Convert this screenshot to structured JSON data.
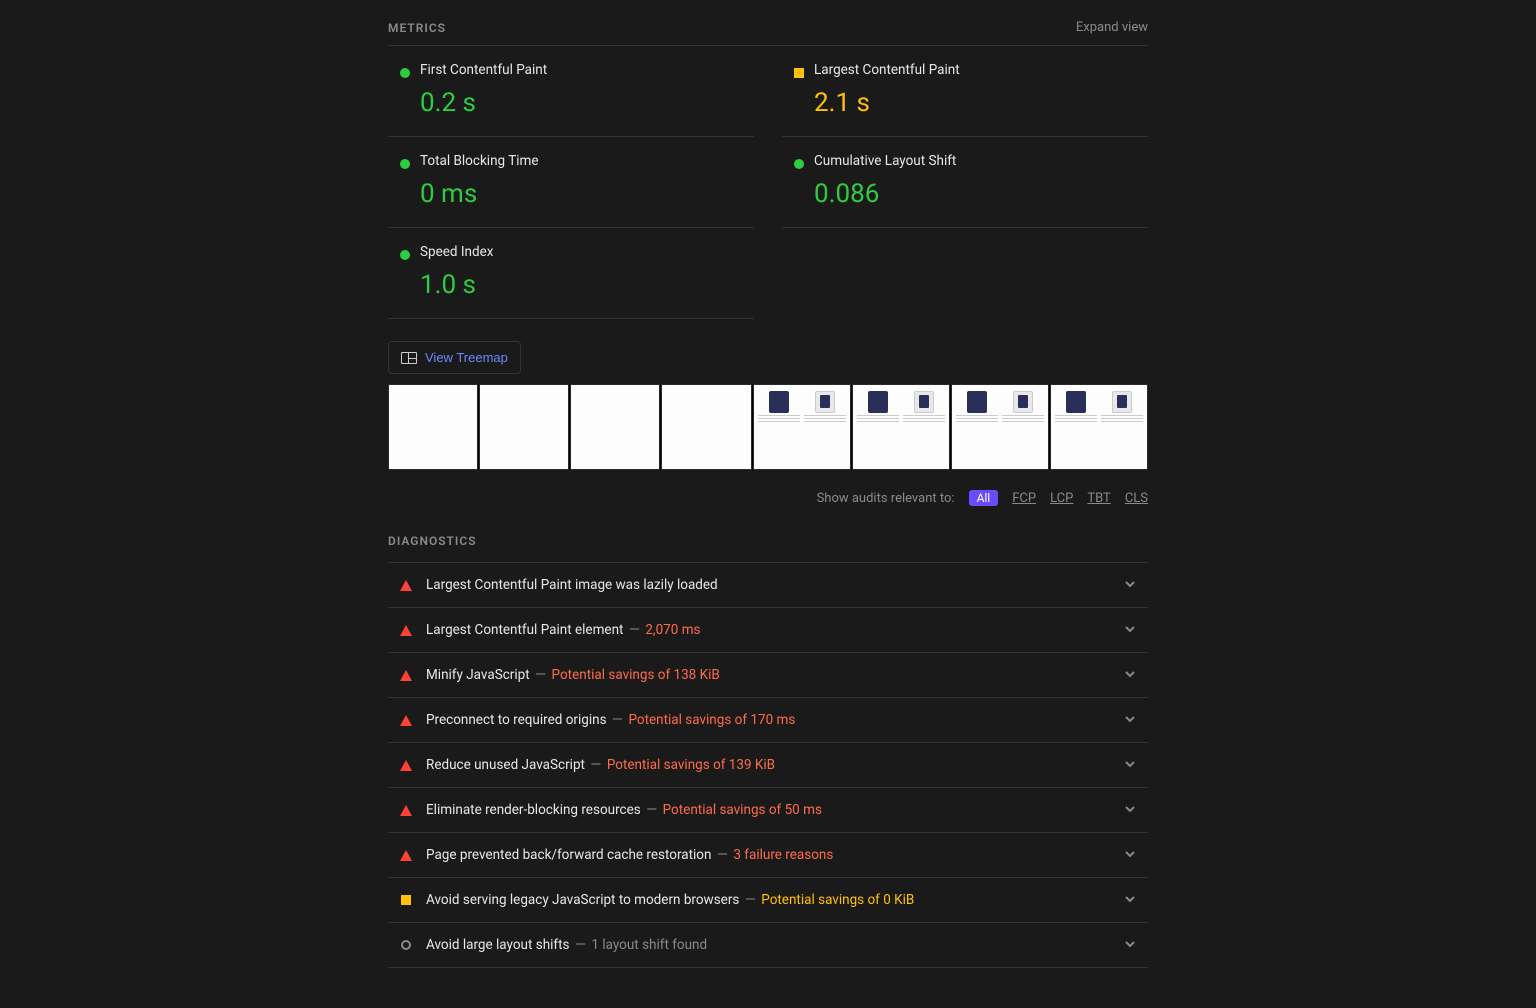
{
  "sections": {
    "metrics_title": "METRICS",
    "expand_view": "Expand view",
    "diagnostics_title": "DIAGNOSTICS"
  },
  "metrics": [
    {
      "label": "First Contentful Paint",
      "value": "0.2 s",
      "status": "green"
    },
    {
      "label": "Largest Contentful Paint",
      "value": "2.1 s",
      "status": "yellow"
    },
    {
      "label": "Total Blocking Time",
      "value": "0 ms",
      "status": "green"
    },
    {
      "label": "Cumulative Layout Shift",
      "value": "0.086",
      "status": "green"
    },
    {
      "label": "Speed Index",
      "value": "1.0 s",
      "status": "green"
    }
  ],
  "treemap_button": "View Treemap",
  "audit_filter": {
    "label": "Show audits relevant to:",
    "options": [
      "All",
      "FCP",
      "LCP",
      "TBT",
      "CLS"
    ],
    "active": "All"
  },
  "diagnostics": [
    {
      "status": "red",
      "title": "Largest Contentful Paint image was lazily loaded",
      "detail": "",
      "detail_tone": ""
    },
    {
      "status": "red",
      "title": "Largest Contentful Paint element",
      "detail": "2,070 ms",
      "detail_tone": "red"
    },
    {
      "status": "red",
      "title": "Minify JavaScript",
      "detail": "Potential savings of 138 KiB",
      "detail_tone": "red"
    },
    {
      "status": "red",
      "title": "Preconnect to required origins",
      "detail": "Potential savings of 170 ms",
      "detail_tone": "red"
    },
    {
      "status": "red",
      "title": "Reduce unused JavaScript",
      "detail": "Potential savings of 139 KiB",
      "detail_tone": "red"
    },
    {
      "status": "red",
      "title": "Eliminate render-blocking resources",
      "detail": "Potential savings of 50 ms",
      "detail_tone": "red"
    },
    {
      "status": "red",
      "title": "Page prevented back/forward cache restoration",
      "detail": "3 failure reasons",
      "detail_tone": "red"
    },
    {
      "status": "yellow",
      "title": "Avoid serving legacy JavaScript to modern browsers",
      "detail": "Potential savings of 0 KiB",
      "detail_tone": "yellow"
    },
    {
      "status": "grey",
      "title": "Avoid large layout shifts",
      "detail": "1 layout shift found",
      "detail_tone": "grey"
    }
  ],
  "filmstrip_loaded_from_index": 4,
  "filmstrip_count": 8
}
